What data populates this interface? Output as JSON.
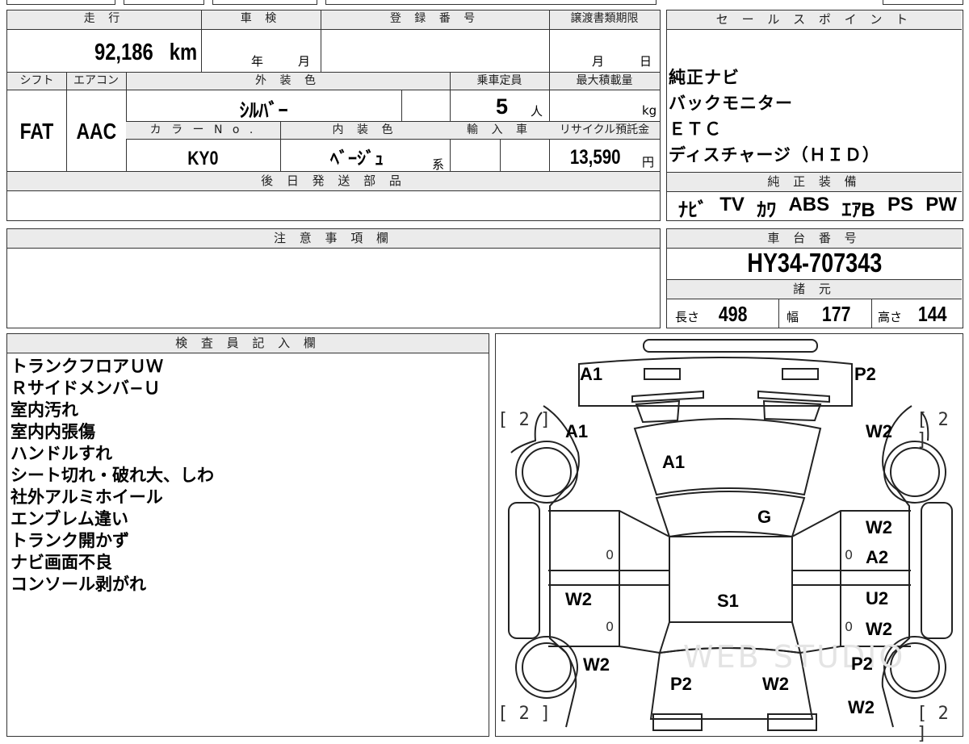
{
  "header": {
    "mileage_label": "走 行",
    "mileage_value": "92,186",
    "mileage_unit": "km",
    "shaken_label": "車 検",
    "shaken_year": "年",
    "shaken_month": "月",
    "registration_label": "登 録 番 号",
    "deadline_label": "譲渡書類期限",
    "deadline_month": "月",
    "deadline_day": "日"
  },
  "specs": {
    "shift_label": "シフト",
    "shift_value": "FAT",
    "aircon_label": "エアコン",
    "aircon_value": "AAC",
    "exterior_label": "外 装 色",
    "exterior_value": "ｼﾙﾊﾞｰ",
    "capacity_label": "乗車定員",
    "capacity_value": "5",
    "capacity_unit": "人",
    "maxload_label": "最大積載量",
    "maxload_unit": "kg",
    "colorno_label": "カ ラ ー N o .",
    "colorno_value": "KY0",
    "interior_label": "内 装 色",
    "interior_value": "ﾍﾞｰｼﾞｭ",
    "interior_suffix": "系",
    "import_label": "輸 入 車",
    "recycle_label": "リサイクル預託金",
    "recycle_value": "13,590",
    "recycle_unit": "円",
    "later_parts_label": "後 日 発 送 部 品"
  },
  "sales": {
    "label": "セ ー ル ス ポ イ ン ト",
    "points": [
      "純正ナビ",
      "バックモニター",
      "ＥＴＣ",
      "ディスチャージ（ＨＩＤ）"
    ]
  },
  "equipment": {
    "label": "純 正 装 備",
    "items": [
      "ﾅﾋﾞ",
      "TV",
      "ｶﾜ",
      "ABS",
      "ｴｱB",
      "PS",
      "PW"
    ]
  },
  "notes": {
    "label": "注 意 事 項 欄"
  },
  "chassis": {
    "label": "車 台 番 号",
    "value": "HY34-707343"
  },
  "dimensions": {
    "label": "諸 元",
    "length_label": "長さ",
    "length_value": "498",
    "width_label": "幅",
    "width_value": "177",
    "height_label": "高さ",
    "height_value": "144"
  },
  "inspector": {
    "label": "検 査 員 記 入 欄",
    "remarks": [
      "トランクフロアＵＷ",
      "Ｒサイドメンバ−Ｕ",
      "室内汚れ",
      "室内内張傷",
      "ハンドルすれ",
      "シート切れ・破れ大、しわ",
      "社外アルミホイール",
      "エンブレム違い",
      "トランク開かず",
      "ナビ画面不良",
      "コンソール剥がれ"
    ]
  },
  "diagram": {
    "tire_tl": "[ 2 ]",
    "tire_tr": "[ 2 ]",
    "tire_bl": "[ 2 ]",
    "tire_br": "[ 2 ]",
    "front_bumper_left": "A1",
    "front_bumper_right": "P2",
    "front_fender_left": "A1",
    "front_fender_right": "W2",
    "hood": "A1",
    "windshield": "G",
    "front_door_right_top": "W2",
    "front_door_right": "A2",
    "rear_door_left": "W2",
    "roof": "S1",
    "rear_door_right_top": "U2",
    "rear_door_right": "W2",
    "rear_quarter_left": "W2",
    "rear_quarter_right": "P2",
    "trunk_left": "P2",
    "trunk_right": "W2",
    "rear_bumper_right": "W2",
    "zero": "0",
    "watermark": "WEB STUDIO"
  }
}
